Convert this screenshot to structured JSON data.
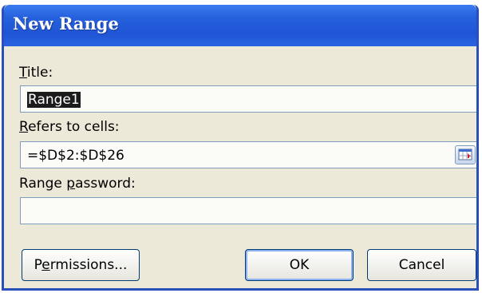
{
  "window": {
    "title": "New Range"
  },
  "title_field": {
    "label_accel": "T",
    "label_rest": "itle:",
    "value": "Range1"
  },
  "refers_field": {
    "label_accel": "R",
    "label_rest": "efers to cells:",
    "value": "=$D$2:$D$26",
    "collapse_icon": "range-select-icon"
  },
  "password_field": {
    "label_before": "Range ",
    "label_accel": "p",
    "label_rest": "assword:",
    "value": ""
  },
  "buttons": {
    "permissions_before": "P",
    "permissions_accel": "e",
    "permissions_rest": "rmissions...",
    "ok": "OK",
    "cancel": "Cancel"
  },
  "colors": {
    "titlebar": "#2661dd",
    "dialog_bg": "#ece9d8",
    "field_border": "#7f9db9"
  }
}
